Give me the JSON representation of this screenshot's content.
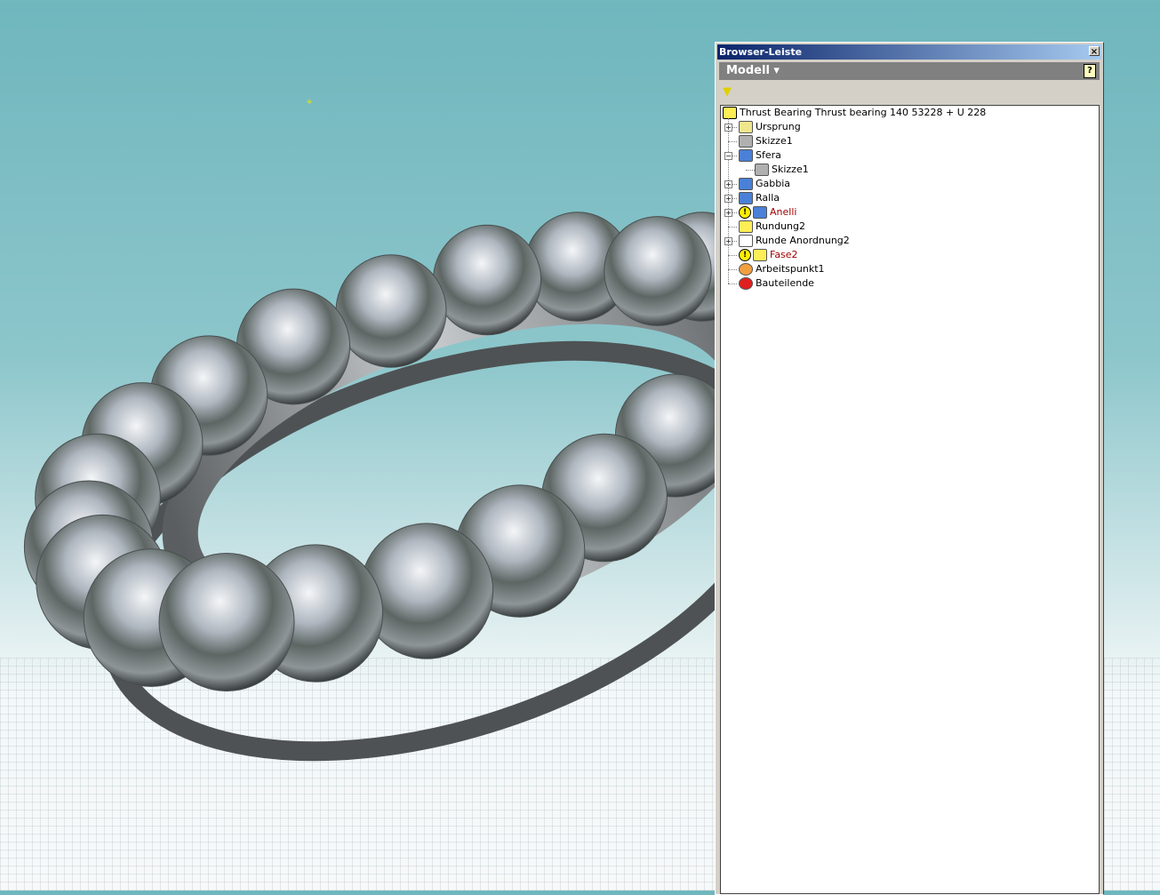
{
  "panel": {
    "title": "Browser-Leiste",
    "close": "×",
    "dropdown": "Modell ▾",
    "help": "?",
    "filter_icon": "filter-icon"
  },
  "tree": {
    "root": "Thrust Bearing Thrust bearing 140 53228 + U 228",
    "items": [
      {
        "label": "Ursprung",
        "icon": "folder-icon",
        "expander": "+",
        "warn": false,
        "color": "#000000"
      },
      {
        "label": "Skizze1",
        "icon": "sketch-icon",
        "expander": "",
        "warn": false,
        "color": "#000000"
      },
      {
        "label": "Sfera",
        "icon": "revolve-icon",
        "expander": "−",
        "warn": false,
        "color": "#000000"
      },
      {
        "label": "Skizze1",
        "icon": "sketch-icon",
        "expander": "",
        "warn": false,
        "color": "#000000",
        "child": true
      },
      {
        "label": "Gabbia",
        "icon": "revolve-icon",
        "expander": "+",
        "warn": false,
        "color": "#000000"
      },
      {
        "label": "Ralla",
        "icon": "revolve-icon",
        "expander": "+",
        "warn": false,
        "color": "#000000"
      },
      {
        "label": "Anelli",
        "icon": "revolve-icon",
        "expander": "+",
        "warn": true,
        "color": "#a00000"
      },
      {
        "label": "Rundung2",
        "icon": "fillet-icon",
        "expander": "",
        "warn": false,
        "color": "#000000"
      },
      {
        "label": "Runde Anordnung2",
        "icon": "circular-pattern-icon",
        "expander": "+",
        "warn": false,
        "color": "#000000"
      },
      {
        "label": "Fase2",
        "icon": "chamfer-icon",
        "expander": "",
        "warn": true,
        "color": "#a00000"
      },
      {
        "label": "Arbeitspunkt1",
        "icon": "work-point-icon",
        "expander": "",
        "warn": false,
        "color": "#000000"
      },
      {
        "label": "Bauteilende",
        "icon": "end-of-part-icon",
        "expander": "",
        "warn": false,
        "color": "#000000"
      }
    ]
  }
}
